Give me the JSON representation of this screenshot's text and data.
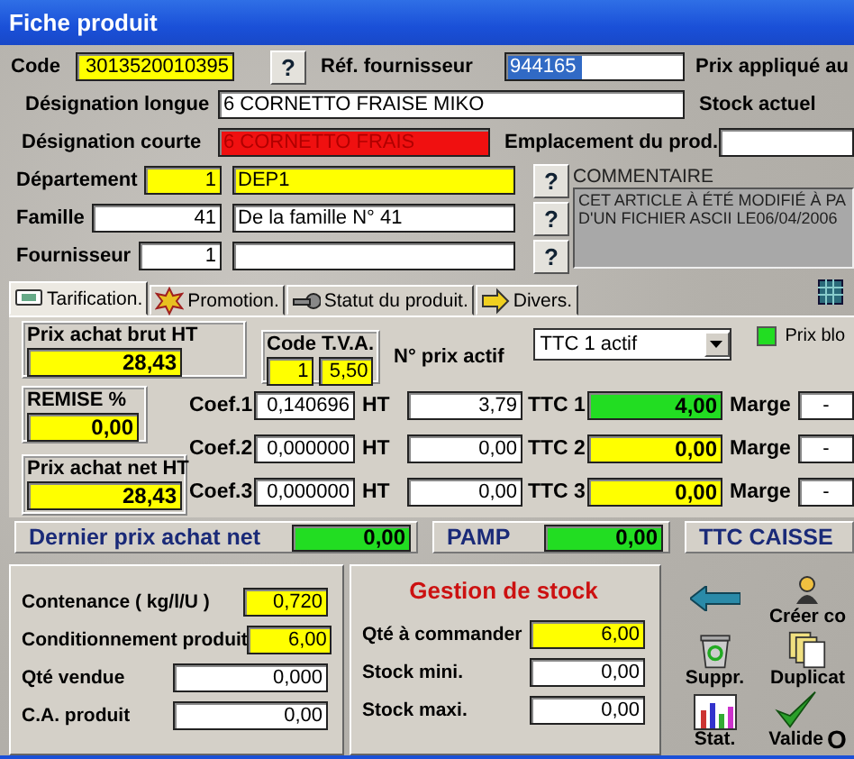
{
  "window": {
    "title": "Fiche produit"
  },
  "identity": {
    "code": {
      "label": "Code",
      "value": "3013520010395",
      "kind": "required",
      "lookup": "?"
    },
    "ref_fournisseur": {
      "label": "Réf. fournisseur",
      "value": "944165",
      "kind": "plain",
      "text_selected": true
    },
    "prix_applique": {
      "label": "Prix appliqué au"
    },
    "designation_longue": {
      "label": "Désignation longue",
      "value": "6 CORNETTO FRAISE   MIKO",
      "kind": "plain"
    },
    "stock_actuel": {
      "label": "Stock actuel"
    },
    "designation_courte": {
      "label": "Désignation courte",
      "value": "6 CORNETTO FRAIS",
      "kind": "alert"
    },
    "emplacement": {
      "label": "Emplacement du prod.",
      "kind": "plain"
    }
  },
  "references": [
    {
      "label": "Département",
      "code": "1",
      "name": "DEP1",
      "kind": "required",
      "lookup": "?"
    },
    {
      "label": "Famille",
      "code": "41",
      "name": "De la famille N° 41",
      "kind": "plain",
      "lookup": "?"
    },
    {
      "label": "Fournisseur",
      "code": "1",
      "kind": "plain",
      "lookup": "?"
    }
  ],
  "comment": {
    "label": "COMMENTAIRE",
    "lines": [
      "CET ARTICLE À ÉTÉ MODIFIÉ À PA",
      "D'UN FICHIER ASCII LE06/04/2006"
    ]
  },
  "tabs": [
    {
      "label": "Tarification.",
      "selected": true
    },
    {
      "label": "Promotion.",
      "selected": false
    },
    {
      "label": "Statut du produit.",
      "selected": false
    },
    {
      "label": "Divers.",
      "selected": false
    }
  ],
  "pricing": {
    "prix_achat_brut": {
      "label": "Prix achat brut HT",
      "value": "28,43"
    },
    "code_tva": {
      "label": "Code T.V.A.",
      "code": "1",
      "rate": "5,50"
    },
    "prix_actif": {
      "label": "N° prix actif",
      "value": "TTC 1 actif"
    },
    "prix_bloque": {
      "label": "Prix blo",
      "on": true
    },
    "remise": {
      "label": "REMISE %",
      "value": "0,00"
    },
    "prix_achat_net": {
      "label": "Prix achat net HT",
      "value": "28,43"
    },
    "rows": [
      {
        "coef_label": "Coef.1",
        "coef": "0,140696",
        "ht_label": "HT",
        "ht": "3,79",
        "ttc_label": "TTC 1",
        "ttc": "4,00",
        "selected": true,
        "marge_label": "Marge",
        "marge": "-"
      },
      {
        "coef_label": "Coef.2",
        "coef": "0,000000",
        "ht_label": "HT",
        "ht": "0,00",
        "ttc_label": "TTC 2",
        "ttc": "0,00",
        "selected": false,
        "marge_label": "Marge",
        "marge": "-"
      },
      {
        "coef_label": "Coef.3",
        "coef": "0,000000",
        "ht_label": "HT",
        "ht": "0,00",
        "ttc_label": "TTC 3",
        "ttc": "0,00",
        "selected": false,
        "marge_label": "Marge",
        "marge": "-"
      }
    ]
  },
  "summary": [
    {
      "label": "Dernier prix achat net",
      "value": "0,00"
    },
    {
      "label": "PAMP",
      "value": "0,00"
    },
    {
      "label": "TTC CAISSE"
    }
  ],
  "quantities": [
    {
      "label": "Contenance ( kg/l/U )",
      "value": "0,720",
      "kind": "required"
    },
    {
      "label": "Conditionnement produit",
      "value": "6,00",
      "kind": "required"
    },
    {
      "label": "Qté vendue",
      "value": "0,000",
      "kind": "plain"
    },
    {
      "label": "C.A. produit",
      "value": "0,00",
      "kind": "plain"
    }
  ],
  "stock": {
    "title": "Gestion de stock",
    "fields": [
      {
        "label": "Qté à commander",
        "value": "6,00",
        "kind": "required"
      },
      {
        "label": "Stock mini.",
        "value": "0,00",
        "kind": "plain"
      },
      {
        "label": "Stock maxi.",
        "value": "0,00",
        "kind": "plain"
      }
    ]
  },
  "actions": [
    {
      "kind": "back"
    },
    {
      "kind": "create",
      "label": "Créer co"
    },
    {
      "kind": "delete",
      "label": "Suppr."
    },
    {
      "kind": "duplicate",
      "label": "Duplicat"
    },
    {
      "kind": "stats",
      "label": "Stat."
    },
    {
      "kind": "validate",
      "label": "Valide",
      "tag": "O"
    }
  ]
}
